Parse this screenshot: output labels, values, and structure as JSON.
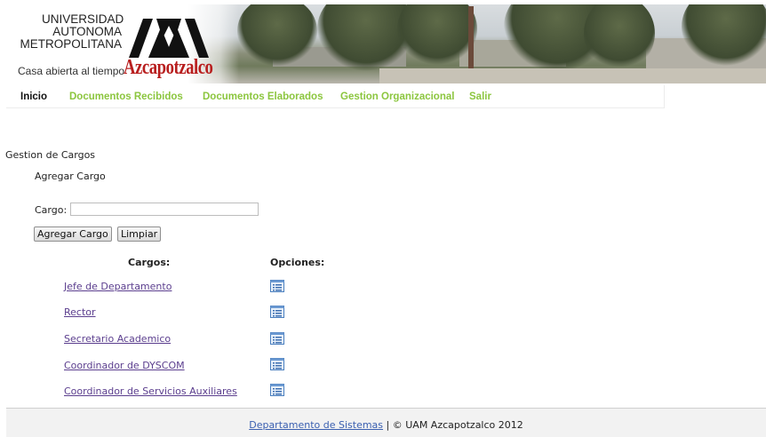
{
  "header": {
    "university_line1": "UNIVERSIDAD",
    "university_line2": "AUTONOMA",
    "university_line3": "METROPOLITANA",
    "tagline": "Casa abierta al tiempo",
    "campus": "Azcapotzalco"
  },
  "nav": {
    "items": [
      {
        "label": "Inicio"
      },
      {
        "label": "Documentos Recibidos"
      },
      {
        "label": "Documentos Elaborados"
      },
      {
        "label": "Gestion Organizacional"
      },
      {
        "label": "Salir"
      }
    ]
  },
  "main": {
    "section_title": "Gestion de Cargos",
    "sub_title": "Agregar Cargo",
    "cargo_label": "Cargo:",
    "cargo_value": "",
    "add_button": "Agregar Cargo",
    "clear_button": "Limpiar",
    "col_cargos": "Cargos:",
    "col_opciones": "Opciones:",
    "cargos": [
      {
        "name": "Jefe de Departamento",
        "icon": "list-icon"
      },
      {
        "name": "Rector",
        "icon": "list-icon"
      },
      {
        "name": "Secretario Academico",
        "icon": "list-icon"
      },
      {
        "name": "Coordinador de DYSCOM",
        "icon": "list-icon"
      },
      {
        "name": "Coordinador de Servicios Auxiliares",
        "icon": "list-icon"
      }
    ]
  },
  "footer": {
    "link": "Departamento de Sistemas",
    "text": "| © UAM Azcapotzalco 2012"
  },
  "colors": {
    "nav_link": "#8cc63f",
    "campus_red": "#b81e1e",
    "visited_link": "#5b3e8e"
  }
}
